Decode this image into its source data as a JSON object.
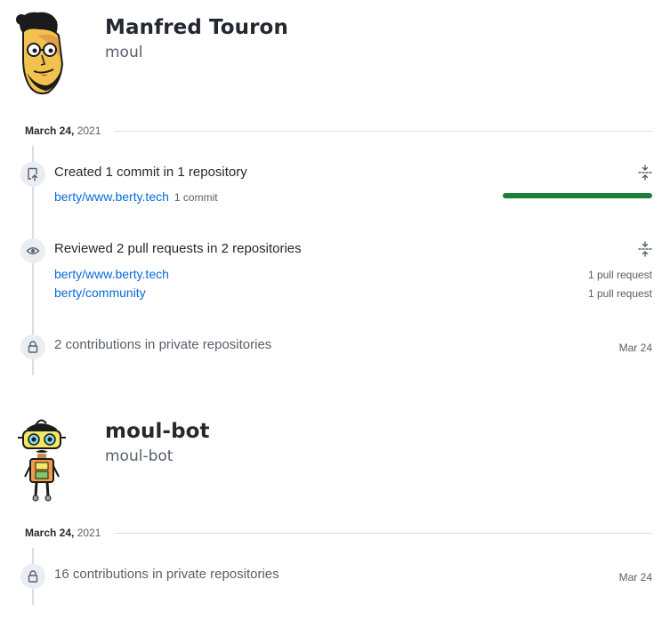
{
  "users": [
    {
      "name": "Manfred Touron",
      "login": "moul",
      "date": {
        "day": "March 24,",
        "year": "2021"
      },
      "activities": [
        {
          "icon": "repo-push-icon",
          "title": "Created 1 commit in 1 repository",
          "repos": [
            {
              "name": "berty/www.berty.tech",
              "count": "1 commit",
              "progress": 1.0
            }
          ]
        },
        {
          "icon": "eye-icon",
          "title": "Reviewed 2 pull requests in 2 repositories",
          "repos": [
            {
              "name": "berty/www.berty.tech",
              "count": "1 pull request"
            },
            {
              "name": "berty/community",
              "count": "1 pull request"
            }
          ]
        },
        {
          "icon": "lock-icon",
          "title": "2 contributions in private repositories",
          "date": "Mar 24"
        }
      ]
    },
    {
      "name": "moul-bot",
      "login": "moul-bot",
      "date": {
        "day": "March 24,",
        "year": "2021"
      },
      "activities": [
        {
          "icon": "lock-icon",
          "title": "16 contributions in private repositories",
          "date": "Mar 24"
        }
      ]
    }
  ],
  "colors": {
    "link": "#0969da",
    "progress": "#1a7f37",
    "badge_bg": "#eaeef2",
    "line": "#d8dee4"
  }
}
